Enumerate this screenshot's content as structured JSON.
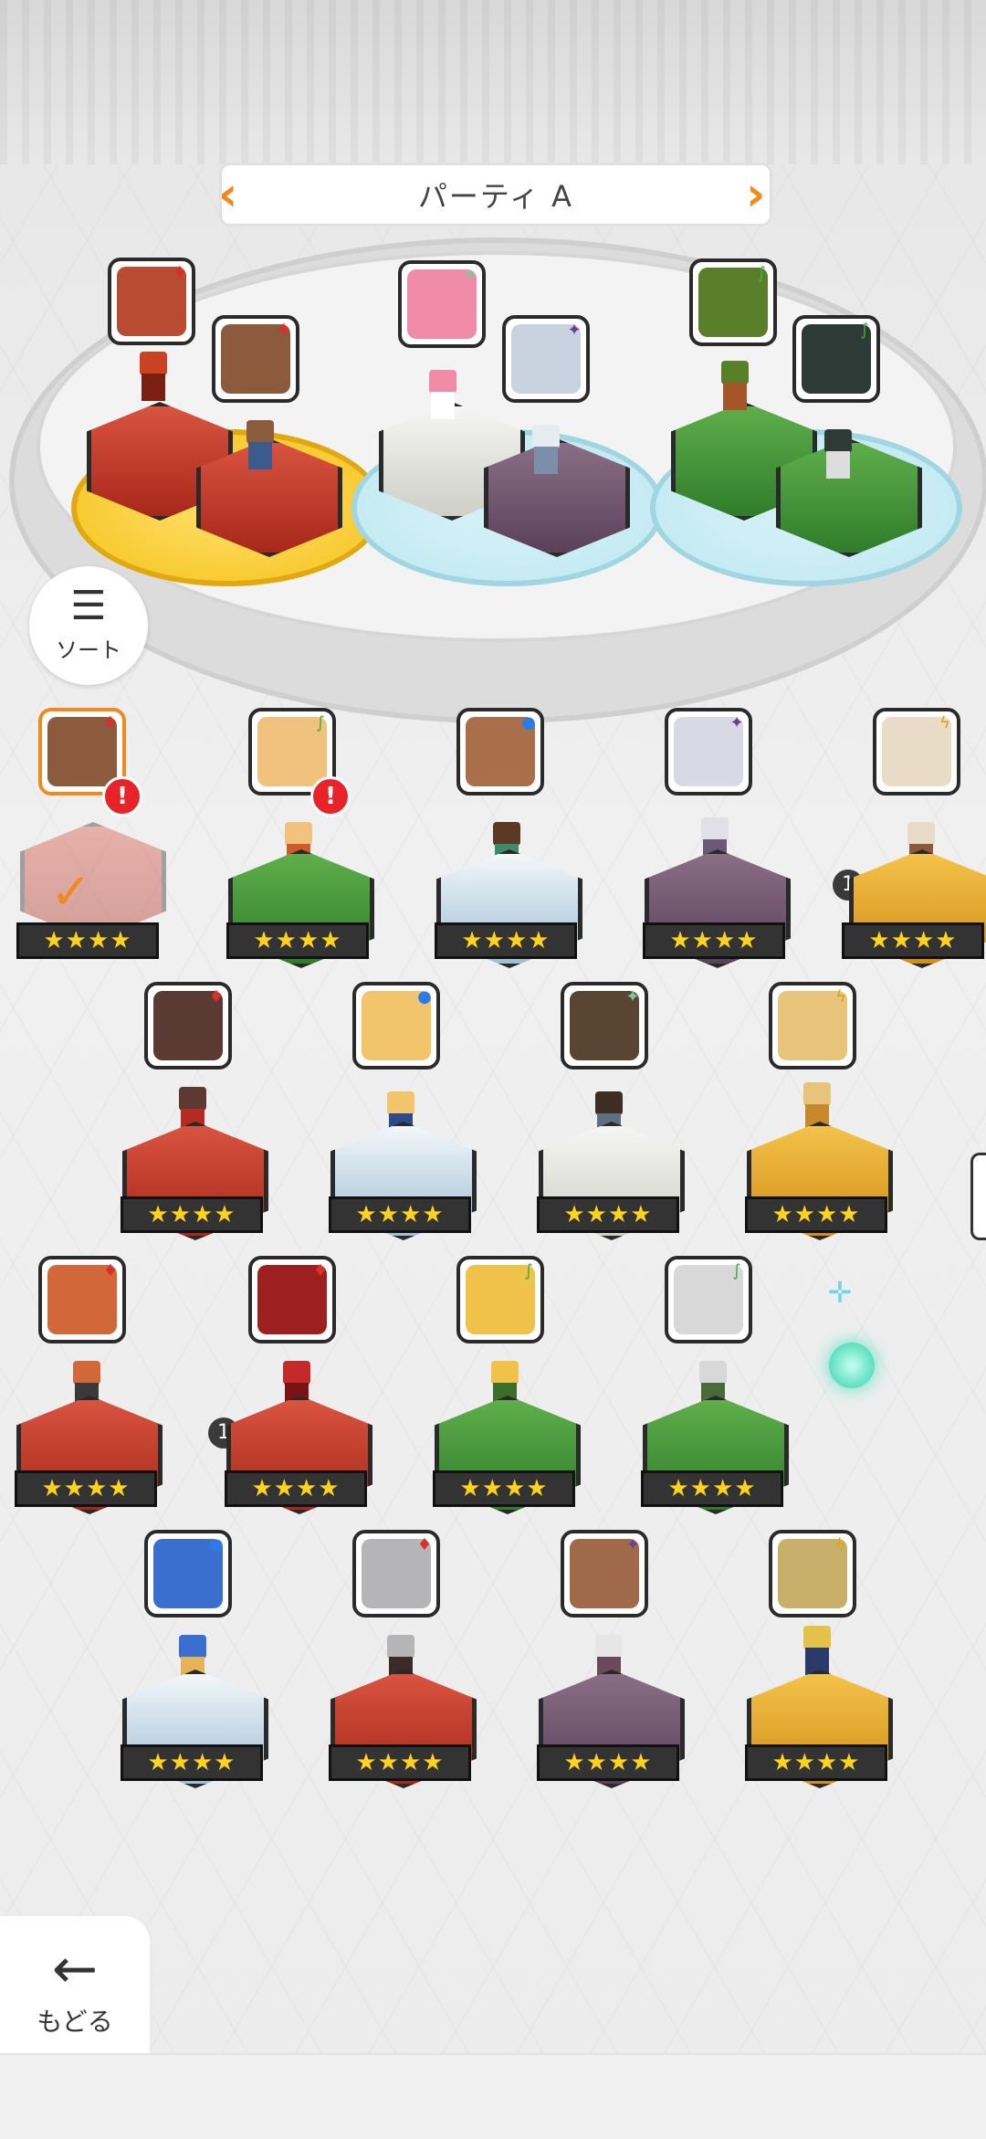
{
  "header": {
    "party_title": "パーティ A",
    "left_arrow": "‹",
    "right_arrow": "›"
  },
  "controls": {
    "sort_label": "ソート",
    "sort_icon": "sort-icon",
    "back_label": "もどる",
    "back_icon": "back-arrow-icon"
  },
  "party_slots": [
    {
      "attr": "red",
      "attr_glyph": "♦",
      "face": "#b84b32"
    },
    {
      "attr": "red",
      "attr_glyph": "♦",
      "face": "#8c5a3c"
    },
    {
      "attr": "white",
      "attr_glyph": "✦",
      "face": "#f08ca8"
    },
    {
      "attr": "purple",
      "attr_glyph": "✦",
      "face": "#c9d3df"
    },
    {
      "attr": "green",
      "attr_glyph": "∫",
      "face": "#5a7f2a"
    },
    {
      "attr": "green",
      "attr_glyph": "∫",
      "face": "#2d3a36"
    }
  ],
  "roster": [
    {
      "attr_glyph": "♦",
      "stars": "★★★★",
      "alert": "!",
      "checked": true
    },
    {
      "attr_glyph": "∫",
      "stars": "★★★★",
      "alert": "!"
    },
    {
      "attr_glyph": "●",
      "stars": "★★★★"
    },
    {
      "attr_glyph": "✦",
      "stars": "★★★★"
    },
    {
      "attr_glyph": "ϟ",
      "stars": "★★★★",
      "badge": "1"
    },
    {
      "attr_glyph": "♦",
      "stars": "★★★★"
    },
    {
      "attr_glyph": "●",
      "stars": "★★★★"
    },
    {
      "attr_glyph": "✦",
      "stars": "★★★★"
    },
    {
      "attr_glyph": "ϟ",
      "stars": "★★★★"
    },
    {
      "attr_glyph": "♦",
      "stars": "★★★★"
    },
    {
      "attr_glyph": "♦",
      "stars": "★★★★",
      "badge": "1"
    },
    {
      "attr_glyph": "∫",
      "stars": "★★★★"
    },
    {
      "attr_glyph": "∫",
      "stars": "★★★★"
    },
    {
      "attr_glyph": "●",
      "stars": "★★★★"
    },
    {
      "attr_glyph": "♦",
      "stars": "★★★★"
    },
    {
      "attr_glyph": "✦",
      "stars": "★★★★"
    },
    {
      "attr_glyph": "ϟ",
      "stars": "★★★★"
    }
  ],
  "colors": {
    "accent": "#f08a1c",
    "alert": "#e8242a",
    "star": "#ffd21e"
  }
}
